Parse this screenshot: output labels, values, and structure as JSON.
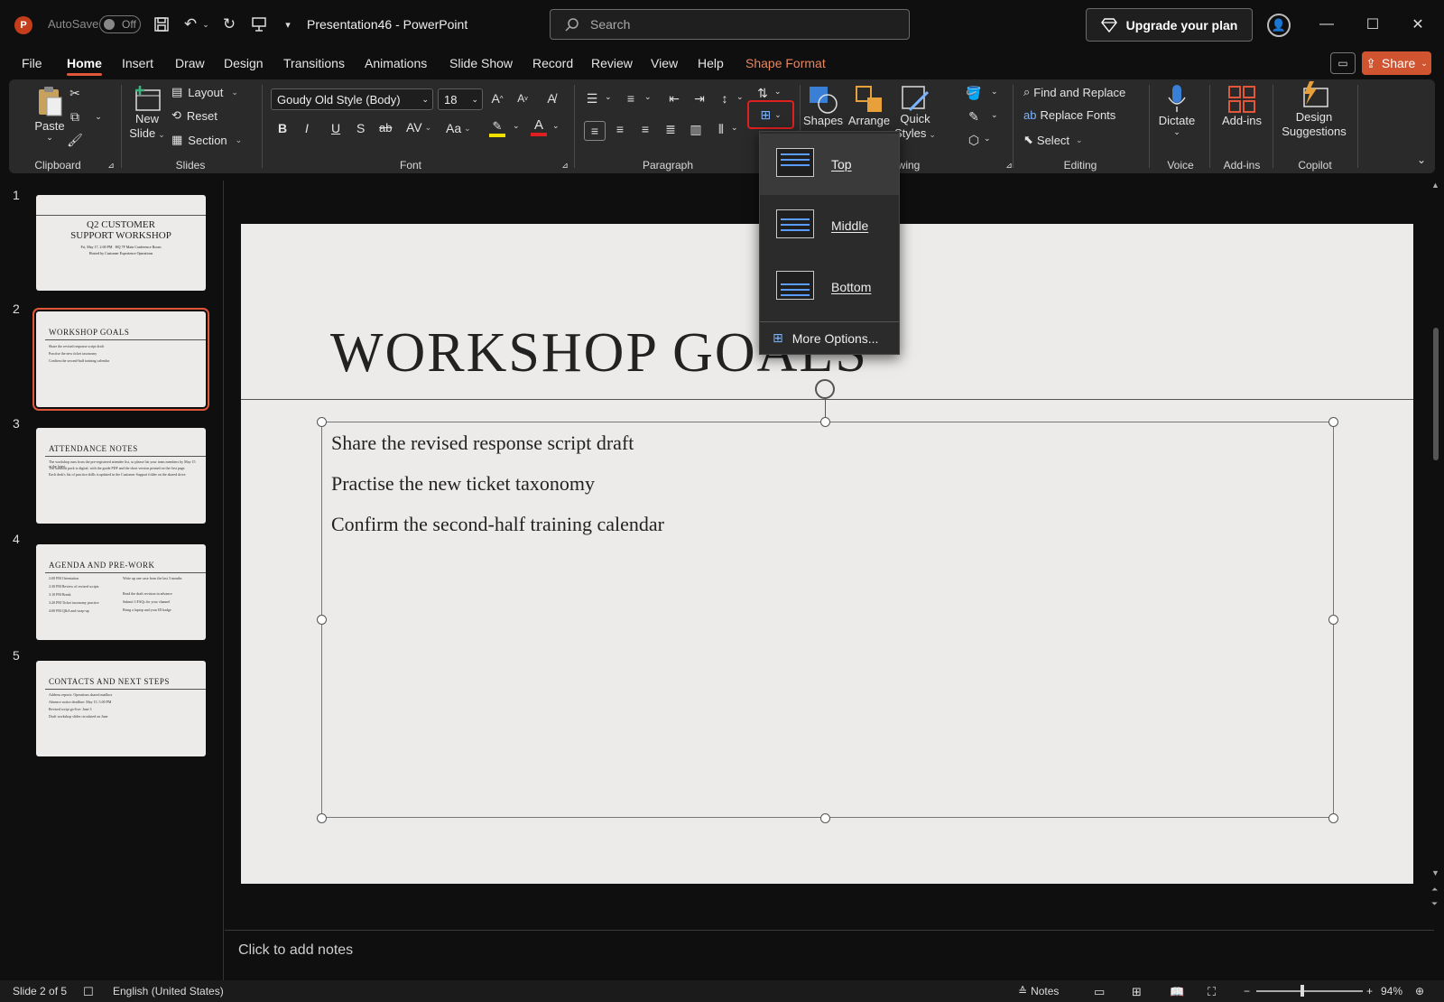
{
  "titlebar": {
    "app_icon": "P",
    "autosave_label": "AutoSave",
    "autosave_state": "Off",
    "doc_title": "Presentation46  -  PowerPoint",
    "search_placeholder": "Search",
    "upgrade_label": "Upgrade your plan",
    "qa_icons": [
      "save-icon",
      "undo-icon",
      "redo-icon",
      "present-from-start-icon",
      "customize-qat-icon"
    ]
  },
  "menu": {
    "tabs": [
      "File",
      "Home",
      "Insert",
      "Draw",
      "Design",
      "Transitions",
      "Animations",
      "Slide Show",
      "Record",
      "Review",
      "View",
      "Help",
      "Shape Format"
    ],
    "active": "Home",
    "share_label": "Share"
  },
  "ribbon": {
    "clipboard": {
      "paste": "Paste",
      "label": "Clipboard"
    },
    "slides": {
      "new_slide": "New",
      "new_slide_2": "Slide",
      "layout": "Layout",
      "reset": "Reset",
      "section": "Section",
      "label": "Slides"
    },
    "font": {
      "family": "Goudy Old Style (Body)",
      "size": "18",
      "bold": "B",
      "italic": "I",
      "underline": "U",
      "shadow": "S",
      "strike": "ab",
      "spacing": "AV",
      "case": "Aa",
      "label": "Font"
    },
    "paragraph": {
      "label": "Paragraph"
    },
    "drawing": {
      "shapes": "Shapes",
      "arrange": "Arrange",
      "quick_styles_1": "Quick",
      "quick_styles_2": "Styles",
      "label": "wing"
    },
    "editing": {
      "find_replace": "Find and Replace",
      "replace_fonts": "Replace Fonts",
      "select": "Select",
      "label": "Editing"
    },
    "voice": {
      "dictate": "Dictate",
      "label": "Voice"
    },
    "addins": {
      "addins": "Add-ins",
      "label": "Add-ins"
    },
    "copilot": {
      "design_1": "Design",
      "design_2": "Suggestions",
      "label": "Copilot"
    }
  },
  "align_text_menu": {
    "items": [
      "Top",
      "Middle",
      "Bottom"
    ],
    "more": "More Options..."
  },
  "thumbnails": [
    {
      "num": "1",
      "title_1": "Q2 CUSTOMER",
      "title_2": "SUPPORT WORKSHOP",
      "sub_1": "Fri, May 17, 2:00 PM · HQ 7F Main Conference Room",
      "sub_2": "Hosted by Customer Experience Operations"
    },
    {
      "num": "2",
      "title": "WORKSHOP GOALS",
      "lines": [
        "Share the revised response script draft",
        "Practise the new ticket taxonomy",
        "Confirm the second-half training calendar"
      ]
    },
    {
      "num": "3",
      "title": "ATTENDANCE NOTES",
      "lines": [
        "The workshop runs from the pre-registered attendee list, so please list your team members by May 15 at the latest.",
        "The handout pack is digital, with the guide PDF and the short version printed on the first page.",
        "Each desk's list of practice drills is updated in the Customer Support folder on the shared drive."
      ]
    },
    {
      "num": "4",
      "title": "AGENDA AND PRE-WORK",
      "left": [
        "2:00 PM Orientation",
        "2:30 PM Review of revised scripts",
        "3:10 PM Break",
        "3:20 PM Ticket taxonomy practice",
        "4:00 PM Q&A and wrap-up"
      ],
      "right": [
        "Write up one case from the last 3 months",
        "Read the draft revision in advance",
        "Submit 3 FAQs for your channel",
        "Bring a laptop and your ID badge"
      ]
    },
    {
      "num": "5",
      "title": "CONTACTS AND NEXT STEPS",
      "lines": [
        "Address reports: Operations shared mailbox",
        "Absence notice deadline: May 15, 5:00 PM",
        "Revised script go-live: June 3",
        "Draft workshop slides circulated on June"
      ]
    }
  ],
  "slide": {
    "title": "WORKSHOP GOALS",
    "bullets": [
      "Share the revised response script draft",
      "Practise the new ticket taxonomy",
      "Confirm the second-half training calendar"
    ]
  },
  "notes_placeholder": "Click to add notes",
  "status": {
    "slide_of": "Slide 2 of 5",
    "language": "English (United States)",
    "notes": "Notes",
    "zoom": "94%"
  },
  "colors": {
    "accent": "#e0573a",
    "share": "#d15431",
    "shape_format": "#e8865f",
    "highlight_border": "#e02020"
  }
}
